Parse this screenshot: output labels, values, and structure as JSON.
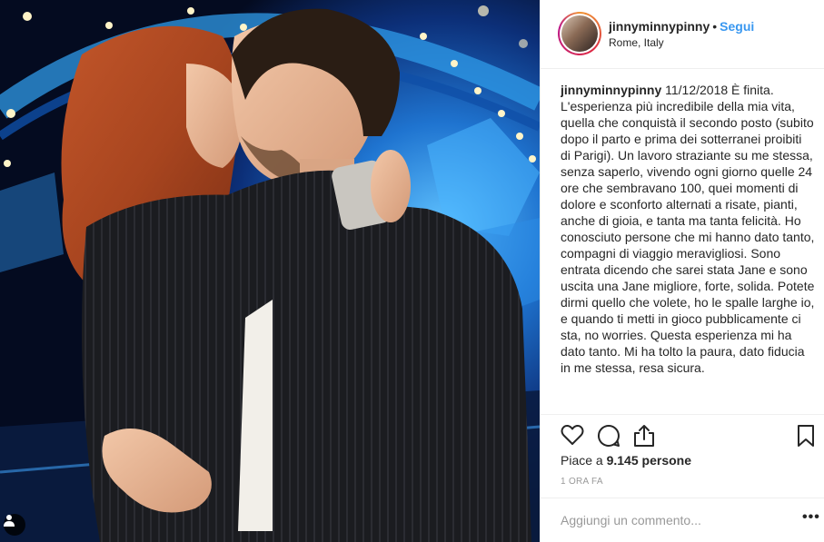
{
  "header": {
    "username": "jinnyminnypinny",
    "separator": "•",
    "follow_label": "Segui",
    "location": "Rome, Italy"
  },
  "caption": {
    "username": "jinnyminnypinny",
    "text": "11/12/2018 È finita. L'esperienza più incredibile della mia vita, quella che conquistà il secondo posto (subito dopo il parto e prima dei sotterranei proibiti di Parigi). Un lavoro straziante su me stessa, senza saperlo, vivendo ogni giorno quelle 24 ore che sembravano 100, quei momenti di dolore e sconforto alternati a risate, pianti, anche di gioia, e tanta ma tanta felicità. Ho conosciuto persone che mi hanno dato tanto, compagni di viaggio meravigliosi. Sono entrata dicendo che sarei stata Jane e sono uscita una Jane migliore, forte, solida. Potete dirmi quello che volete, ho le spalle larghe io, e quando ti metti in gioco pubblicamente ci sta, no worries. Questa esperienza mi ha dato tanto. Mi ha tolto la paura, dato fiducia in me stessa, resa sicura."
  },
  "engagement": {
    "likes_prefix": "Piace a",
    "likes_count": "9.145",
    "likes_suffix": "persone",
    "time_ago": "1 ORA FA"
  },
  "icons": {
    "like": "heart-icon",
    "comment": "comment-icon",
    "share": "share-icon",
    "save": "bookmark-icon",
    "tag": "user-tag-icon",
    "more": "more-options-icon"
  },
  "comment": {
    "placeholder": "Aggiungi un commento...",
    "more_label": "•••"
  },
  "colors": {
    "follow": "#3897f0",
    "text": "#262626",
    "muted": "#999999",
    "border": "#efefef"
  }
}
